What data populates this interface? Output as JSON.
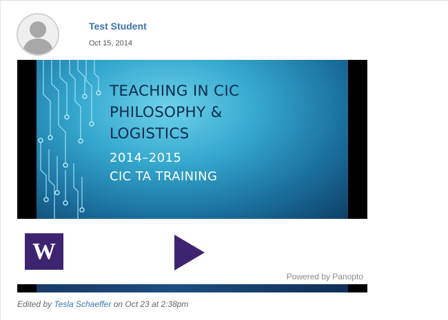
{
  "post": {
    "author": "Test Student",
    "date": "Oct 15, 2014",
    "avatar_icon": "user-silhouette-icon"
  },
  "video": {
    "slide_title_lines": [
      "TEACHING IN CIC",
      "PHILOSOPHY &",
      "LOGISTICS"
    ],
    "slide_subtitle_lines": [
      "2014–2015",
      "CIC TA TRAINING"
    ],
    "logo_letter": "W",
    "play_icon": "play-icon",
    "powered_by": "Powered by Panopto"
  },
  "footer": {
    "edited_prefix": "Edited by",
    "editor": "Tesla Schaeffer",
    "edited_suffix": "on Oct 23 at 2:38pm"
  },
  "colors": {
    "link": "#3b73af",
    "logo_bg": "#3d2470",
    "play": "#3d2470"
  }
}
